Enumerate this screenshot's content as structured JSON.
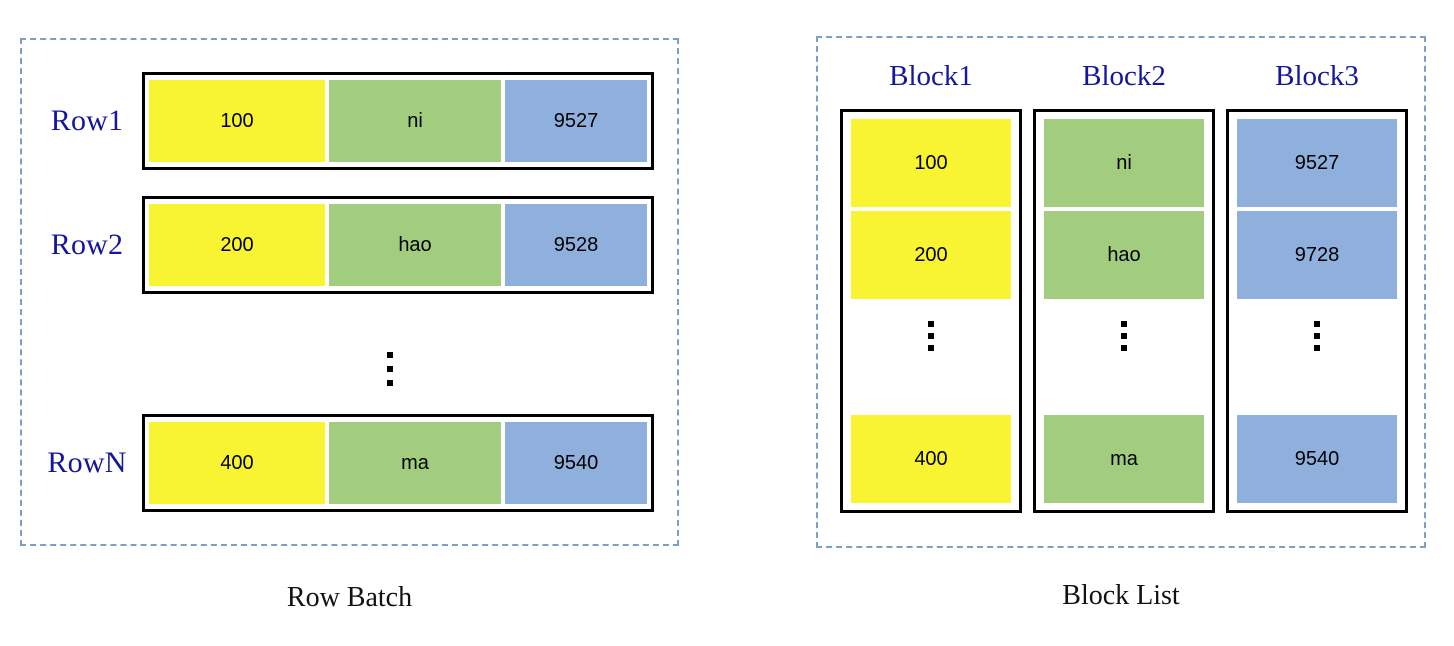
{
  "diagram": {
    "left": {
      "caption": "Row Batch",
      "rows": [
        {
          "label": "Row1",
          "id": "100",
          "name": "ni",
          "num": "9527"
        },
        {
          "label": "Row2",
          "id": "200",
          "name": "hao",
          "num": "9528"
        },
        {
          "label": "RowN",
          "id": "400",
          "name": "ma",
          "num": "9540"
        }
      ],
      "ellipsis": "vertical-ellipsis"
    },
    "right": {
      "caption": "Block List",
      "blocks": [
        {
          "title": "Block1",
          "values": [
            "100",
            "200",
            "400"
          ],
          "color_key": "yellow"
        },
        {
          "title": "Block2",
          "values": [
            "ni",
            "hao",
            "ma"
          ],
          "color_key": "green"
        },
        {
          "title": "Block3",
          "values": [
            "9527",
            "9728",
            "9540"
          ],
          "color_key": "blue"
        }
      ],
      "ellipsis": "vertical-ellipsis"
    }
  },
  "colors": {
    "yellow": "#f9f431",
    "green": "#a2cd7e",
    "blue": "#8fafdc",
    "label_blue": "#14169c",
    "dashed_border": "#7f9ec4",
    "box_border": "#000000",
    "caption_text": "#121212",
    "background": "#ffffff"
  }
}
